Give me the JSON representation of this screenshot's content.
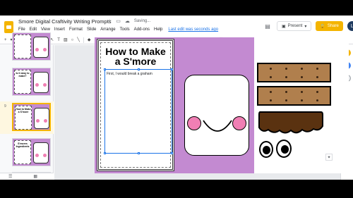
{
  "header": {
    "title": "Smore Digital Craftivity Writing Prompts",
    "saving": "Saving...",
    "menu": [
      "File",
      "Edit",
      "View",
      "Insert",
      "Format",
      "Slide",
      "Arrange",
      "Tools",
      "Add-ons",
      "Help"
    ],
    "last_edit": "Last edit was seconds ago",
    "present_label": "Present",
    "share_label": "Share",
    "avatar_letter": "L"
  },
  "toolbar": {
    "font": "Calibri",
    "size": "18",
    "bold": "B",
    "italic": "I",
    "underline": "U",
    "text_color": "A"
  },
  "filmstrip": {
    "slides": [
      {
        "num": "",
        "label": ""
      },
      {
        "num": "",
        "label": "Is it easy to make?"
      },
      {
        "num": "9",
        "label": "How to Make a S'more"
      },
      {
        "num": "",
        "label": "S'mores Ingredients"
      },
      {
        "num": "",
        "label": "Let's Build a S'more"
      }
    ]
  },
  "slide": {
    "title_line1": "How to Make",
    "title_line2": "a S'more",
    "body_text": "First, I would break a graham"
  },
  "colors": {
    "accent": "#f4b400",
    "slide_bg": "#c38ad1",
    "cracker": "#b07f4d",
    "chocolate": "#5a3210",
    "cheek": "#f07fb4",
    "selection": "#1a73e8"
  }
}
